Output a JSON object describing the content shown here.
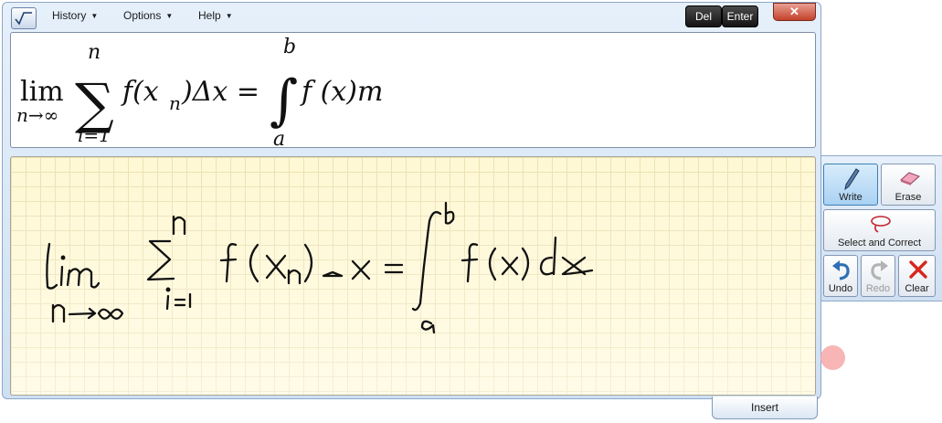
{
  "menu": {
    "history": "History",
    "options": "Options",
    "help": "Help",
    "caret": "▼"
  },
  "buttons": {
    "del": "Del",
    "enter": "Enter",
    "close": "✕",
    "insert": "Insert"
  },
  "tools": {
    "write": "Write",
    "erase": "Erase",
    "select_correct": "Select and Correct",
    "undo": "Undo",
    "redo": "Redo",
    "clear": "Clear"
  },
  "preview": {
    "lim": "lim",
    "lim_sub": "n→∞",
    "sum": "∑",
    "sum_upper": "n",
    "sum_lower": "i=1",
    "term": "f(x",
    "term_sub": "n",
    "term_rest": ")Δx =",
    "integral": "∫",
    "int_upper": "b",
    "int_lower": "a",
    "integrand": "f (x)m"
  },
  "colors": {
    "accent": "#3c7fb1",
    "ink_bg": "#fff8d4",
    "clear_red": "#d7261e"
  }
}
